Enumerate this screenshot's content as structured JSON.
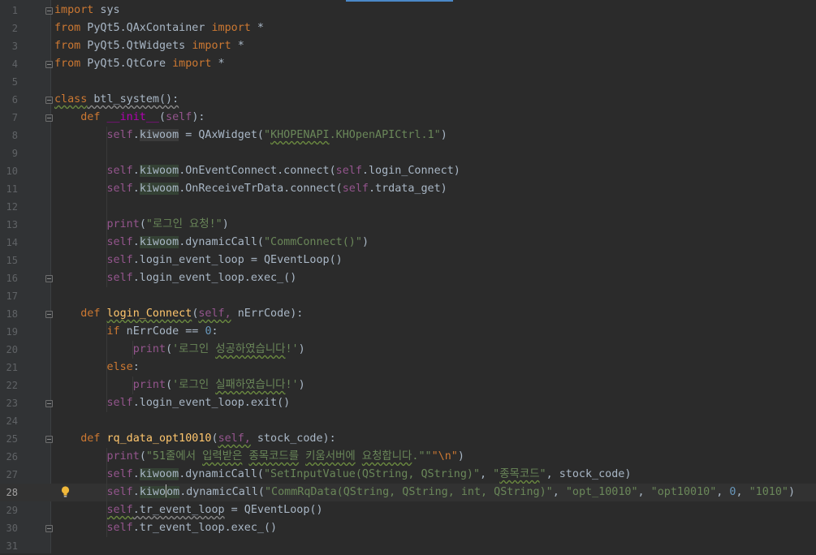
{
  "editor": {
    "current_line": 28
  },
  "lines": [
    {
      "n": "1",
      "segs": [
        {
          "c": "kw",
          "t": "import"
        },
        {
          "c": "",
          "t": " sys"
        }
      ]
    },
    {
      "n": "2",
      "segs": [
        {
          "c": "kw",
          "t": "from"
        },
        {
          "c": "",
          "t": " PyQt5.QAxContainer "
        },
        {
          "c": "kw",
          "t": "import"
        },
        {
          "c": "",
          "t": " *"
        }
      ]
    },
    {
      "n": "3",
      "segs": [
        {
          "c": "kw",
          "t": "from"
        },
        {
          "c": "",
          "t": " PyQt5.QtWidgets "
        },
        {
          "c": "kw",
          "t": "import"
        },
        {
          "c": "",
          "t": " *"
        }
      ]
    },
    {
      "n": "4",
      "segs": [
        {
          "c": "kw",
          "t": "from"
        },
        {
          "c": "",
          "t": " PyQt5.QtCore "
        },
        {
          "c": "kw",
          "t": "import"
        },
        {
          "c": "",
          "t": " *"
        }
      ]
    },
    {
      "n": "5",
      "segs": []
    },
    {
      "n": "6",
      "segs": [
        {
          "c": "kw wavy",
          "t": "class"
        },
        {
          "c": "wavy-w",
          "t": " btl_system():"
        }
      ]
    },
    {
      "n": "7",
      "segs": [
        {
          "c": "",
          "t": "    "
        },
        {
          "c": "kw",
          "t": "def"
        },
        {
          "c": "",
          "t": " "
        },
        {
          "c": "magic",
          "t": "__init__"
        },
        {
          "c": "",
          "t": "("
        },
        {
          "c": "self",
          "t": "self"
        },
        {
          "c": "",
          "t": "):"
        }
      ]
    },
    {
      "n": "8",
      "segs": [
        {
          "c": "",
          "t": "        "
        },
        {
          "c": "self",
          "t": "self"
        },
        {
          "c": "",
          "t": "."
        },
        {
          "c": "hl-w",
          "t": "kiwoom"
        },
        {
          "c": "",
          "t": " = QAxWidget("
        },
        {
          "c": "str",
          "t": "\""
        },
        {
          "c": "str wavy",
          "t": "KHOPENAPI"
        },
        {
          "c": "str",
          "t": ".KHOpenAPICtrl.1\""
        },
        {
          "c": "",
          "t": ")"
        }
      ]
    },
    {
      "n": "9",
      "segs": []
    },
    {
      "n": "10",
      "segs": [
        {
          "c": "",
          "t": "        "
        },
        {
          "c": "self",
          "t": "self"
        },
        {
          "c": "",
          "t": "."
        },
        {
          "c": "hl",
          "t": "kiwoom"
        },
        {
          "c": "",
          "t": ".OnEventConnect.connect("
        },
        {
          "c": "self",
          "t": "self"
        },
        {
          "c": "",
          "t": ".login_Connect)"
        }
      ]
    },
    {
      "n": "11",
      "segs": [
        {
          "c": "",
          "t": "        "
        },
        {
          "c": "self",
          "t": "self"
        },
        {
          "c": "",
          "t": "."
        },
        {
          "c": "hl",
          "t": "kiwoom"
        },
        {
          "c": "",
          "t": ".OnReceiveTrData.connect("
        },
        {
          "c": "self",
          "t": "self"
        },
        {
          "c": "",
          "t": ".trdata_get)"
        }
      ]
    },
    {
      "n": "12",
      "segs": []
    },
    {
      "n": "13",
      "segs": [
        {
          "c": "",
          "t": "        "
        },
        {
          "c": "self",
          "t": "print"
        },
        {
          "c": "",
          "t": "("
        },
        {
          "c": "str",
          "t": "\"로그인 요청!\""
        },
        {
          "c": "",
          "t": ")"
        }
      ]
    },
    {
      "n": "14",
      "segs": [
        {
          "c": "",
          "t": "        "
        },
        {
          "c": "self",
          "t": "self"
        },
        {
          "c": "",
          "t": "."
        },
        {
          "c": "hl",
          "t": "kiwoom"
        },
        {
          "c": "",
          "t": ".dynamicCall("
        },
        {
          "c": "str",
          "t": "\"CommConnect()\""
        },
        {
          "c": "",
          "t": ")"
        }
      ]
    },
    {
      "n": "15",
      "segs": [
        {
          "c": "",
          "t": "        "
        },
        {
          "c": "self",
          "t": "self"
        },
        {
          "c": "",
          "t": ".login_event_loop = QEventLoop()"
        }
      ]
    },
    {
      "n": "16",
      "segs": [
        {
          "c": "",
          "t": "        "
        },
        {
          "c": "self",
          "t": "self"
        },
        {
          "c": "",
          "t": ".login_event_loop.exec_()"
        }
      ]
    },
    {
      "n": "17",
      "segs": []
    },
    {
      "n": "18",
      "segs": [
        {
          "c": "",
          "t": "    "
        },
        {
          "c": "kw",
          "t": "def"
        },
        {
          "c": "",
          "t": " "
        },
        {
          "c": "fn wavy",
          "t": "login_Connect"
        },
        {
          "c": "",
          "t": "("
        },
        {
          "c": "self wavy",
          "t": "self,"
        },
        {
          "c": "",
          "t": " nErrCode):"
        }
      ]
    },
    {
      "n": "19",
      "segs": [
        {
          "c": "",
          "t": "        "
        },
        {
          "c": "kw",
          "t": "if"
        },
        {
          "c": "",
          "t": " nErrCode == "
        },
        {
          "c": "num",
          "t": "0"
        },
        {
          "c": "",
          "t": ":"
        }
      ]
    },
    {
      "n": "20",
      "segs": [
        {
          "c": "",
          "t": "            "
        },
        {
          "c": "self",
          "t": "print"
        },
        {
          "c": "",
          "t": "("
        },
        {
          "c": "str",
          "t": "'로그인 "
        },
        {
          "c": "str wavy",
          "t": "성공하였습니다"
        },
        {
          "c": "str",
          "t": "!'"
        },
        {
          "c": "",
          "t": ")"
        }
      ]
    },
    {
      "n": "21",
      "segs": [
        {
          "c": "",
          "t": "        "
        },
        {
          "c": "kw",
          "t": "else"
        },
        {
          "c": "",
          "t": ":"
        }
      ]
    },
    {
      "n": "22",
      "segs": [
        {
          "c": "",
          "t": "            "
        },
        {
          "c": "self",
          "t": "print"
        },
        {
          "c": "",
          "t": "("
        },
        {
          "c": "str",
          "t": "'로그인 "
        },
        {
          "c": "str wavy",
          "t": "실패하였습니다"
        },
        {
          "c": "str",
          "t": "!'"
        },
        {
          "c": "",
          "t": ")"
        }
      ]
    },
    {
      "n": "23",
      "segs": [
        {
          "c": "",
          "t": "        "
        },
        {
          "c": "self",
          "t": "self"
        },
        {
          "c": "",
          "t": ".login_event_loop.exit()"
        }
      ]
    },
    {
      "n": "24",
      "segs": []
    },
    {
      "n": "25",
      "segs": [
        {
          "c": "",
          "t": "    "
        },
        {
          "c": "kw",
          "t": "def"
        },
        {
          "c": "",
          "t": " "
        },
        {
          "c": "fn",
          "t": "rq_data_opt10010"
        },
        {
          "c": "",
          "t": "("
        },
        {
          "c": "self wavy",
          "t": "self,"
        },
        {
          "c": "",
          "t": " stock_code):"
        }
      ]
    },
    {
      "n": "26",
      "segs": [
        {
          "c": "",
          "t": "        "
        },
        {
          "c": "self",
          "t": "print"
        },
        {
          "c": "",
          "t": "("
        },
        {
          "c": "str",
          "t": "\"51줄에서 "
        },
        {
          "c": "str wavy",
          "t": "입력받은"
        },
        {
          "c": "str",
          "t": " "
        },
        {
          "c": "str wavy",
          "t": "종목코드를"
        },
        {
          "c": "str",
          "t": " "
        },
        {
          "c": "str wavy",
          "t": "키움서버에"
        },
        {
          "c": "str",
          "t": " "
        },
        {
          "c": "str wavy",
          "t": "요청합니다"
        },
        {
          "c": "str",
          "t": ".\"\""
        },
        {
          "c": "esc",
          "t": "\"\\n\""
        },
        {
          "c": "",
          "t": ")"
        }
      ]
    },
    {
      "n": "27",
      "segs": [
        {
          "c": "",
          "t": "        "
        },
        {
          "c": "self",
          "t": "self"
        },
        {
          "c": "",
          "t": "."
        },
        {
          "c": "hl",
          "t": "kiwoom"
        },
        {
          "c": "",
          "t": ".dynamicCall("
        },
        {
          "c": "str",
          "t": "\"SetInputValue(QString, QString)\""
        },
        {
          "c": "",
          "t": ", "
        },
        {
          "c": "str",
          "t": "\""
        },
        {
          "c": "str wavy",
          "t": "종목코드"
        },
        {
          "c": "str",
          "t": "\""
        },
        {
          "c": "",
          "t": ", stock_code)"
        }
      ]
    },
    {
      "n": "28",
      "segs": [
        {
          "c": "",
          "t": "        "
        },
        {
          "c": "self",
          "t": "self"
        },
        {
          "c": "",
          "t": "."
        },
        {
          "c": "hl",
          "t": "kiwo"
        },
        {
          "c": "caret",
          "t": ""
        },
        {
          "c": "hl",
          "t": "om"
        },
        {
          "c": "",
          "t": ".dynamicCall("
        },
        {
          "c": "str",
          "t": "\"CommRqData(QString, QString, int, QString)\""
        },
        {
          "c": "",
          "t": ", "
        },
        {
          "c": "str",
          "t": "\"opt_10010\""
        },
        {
          "c": "",
          "t": ", "
        },
        {
          "c": "str",
          "t": "\"opt10010\""
        },
        {
          "c": "",
          "t": ", "
        },
        {
          "c": "num",
          "t": "0"
        },
        {
          "c": "",
          "t": ", "
        },
        {
          "c": "str",
          "t": "\"1010\""
        },
        {
          "c": "",
          "t": ")"
        }
      ]
    },
    {
      "n": "29",
      "segs": [
        {
          "c": "",
          "t": "        "
        },
        {
          "c": "self wavy",
          "t": "self"
        },
        {
          "c": "wavy-w",
          "t": ".tr_event_loop"
        },
        {
          "c": "",
          "t": " = QEventLoop()"
        }
      ]
    },
    {
      "n": "30",
      "segs": [
        {
          "c": "",
          "t": "        "
        },
        {
          "c": "self",
          "t": "self"
        },
        {
          "c": "",
          "t": ".tr_event_loop.exec_()"
        }
      ]
    },
    {
      "n": "31",
      "segs": []
    }
  ],
  "fold_lines": [
    1,
    4,
    6,
    7,
    16,
    18,
    23,
    25,
    30
  ],
  "bulb_line": 28,
  "icons": {
    "fold": "fold-marker-icon",
    "bulb": "intention-bulb-icon"
  }
}
